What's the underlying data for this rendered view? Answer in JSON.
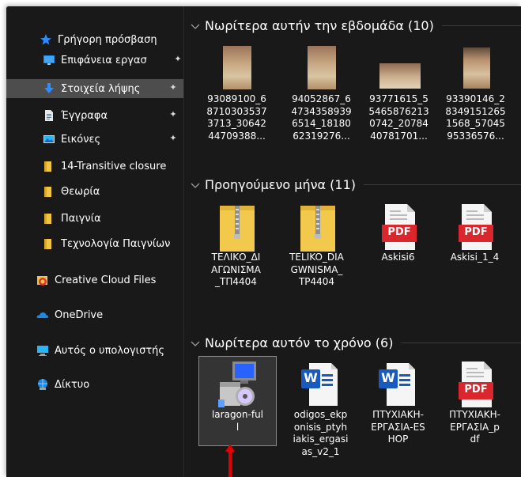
{
  "sidebar": {
    "items": [
      {
        "label": "Γρήγορη πρόσβαση",
        "icon": "star-icon",
        "pinned": false
      },
      {
        "label": "Επιφάνεια εργασ",
        "icon": "desktop-icon",
        "pinned": true
      },
      {
        "label": "Στοιχεία λήψης",
        "icon": "download-icon",
        "pinned": true,
        "selected": true
      },
      {
        "label": "Έγγραφα",
        "icon": "documents-icon",
        "pinned": true
      },
      {
        "label": "Εικόνες",
        "icon": "pictures-icon",
        "pinned": true
      },
      {
        "label": "14-Transitive closure",
        "icon": "folder-icon",
        "pinned": false
      },
      {
        "label": "Θεωρία",
        "icon": "folder-icon",
        "pinned": false
      },
      {
        "label": "Παιγνία",
        "icon": "folder-icon",
        "pinned": false
      },
      {
        "label": "Τεχνολογία Παιγνίων",
        "icon": "folder-icon",
        "pinned": false
      },
      {
        "label": "Creative Cloud Files",
        "icon": "creative-cloud-icon",
        "pinned": false
      },
      {
        "label": "OneDrive",
        "icon": "onedrive-icon",
        "pinned": false
      },
      {
        "label": "Αυτός ο υπολογιστής",
        "icon": "this-pc-icon",
        "pinned": false
      },
      {
        "label": "Δίκτυο",
        "icon": "network-icon",
        "pinned": false
      }
    ]
  },
  "groups": [
    {
      "title": "Νωρίτερα αυτήν την εβδομάδα (10)",
      "items": [
        {
          "name": "93089100_68710303537 3713_3064244709388...",
          "lines": [
            "93089100_6",
            "8710303537",
            "3713_30642",
            "44709388..."
          ],
          "type": "photo"
        },
        {
          "name": "94052867_64734358939 6514_1818062319276...",
          "lines": [
            "94052867_6",
            "4734358939",
            "6514_18180",
            "62319276..."
          ],
          "type": "photo"
        },
        {
          "name": "93771615_55465876213 0742_2078440781701...",
          "lines": [
            "93771615_5",
            "5465876213",
            "0742_20784",
            "40781701..."
          ],
          "type": "photo-wide"
        },
        {
          "name": "93390146_28349151265 1568_5704595336576...",
          "lines": [
            "93390146_2",
            "8349151265",
            "1568_57045",
            "95336576..."
          ],
          "type": "photo-dark"
        }
      ]
    },
    {
      "title": "Προηγούμενο μήνα (11)",
      "items": [
        {
          "lines": [
            "ΤΕΛΙΚΟ_ΔΙ",
            "ΑΓΩΝΙΣΜΑ",
            "_ΤΠ4404"
          ],
          "type": "zip"
        },
        {
          "lines": [
            "TELIKO_DIA",
            "GWNISMA_",
            "TP4404"
          ],
          "type": "zip"
        },
        {
          "lines": [
            "Askisi6"
          ],
          "type": "pdf"
        },
        {
          "lines": [
            "Askisi_1_4"
          ],
          "type": "pdf"
        }
      ]
    },
    {
      "title": "Νωρίτερα αυτόν το χρόνο (6)",
      "items": [
        {
          "lines": [
            "laragon-ful",
            "l"
          ],
          "type": "installer",
          "selected": true
        },
        {
          "lines": [
            "odigos_ekp",
            "onisis_ptyh",
            "iakis_ergasi",
            "as_v2_1"
          ],
          "type": "word"
        },
        {
          "lines": [
            "ΠΤΥΧΙΑΚΗ-",
            "ΕΡΓΑΣΙΑ-ΕS",
            "HOP"
          ],
          "type": "word"
        },
        {
          "lines": [
            "ΠΤΥΧΙΑΚΗ-",
            "ΕΡΓΑΣΙΑ_p",
            "df"
          ],
          "type": "pdf"
        }
      ]
    }
  ],
  "pdf_badge": "PDF",
  "word_badge": "W",
  "colors": {
    "window_bg": "#191919",
    "selected_nav": "#4d4d4d",
    "folder": "#f0c542",
    "pdf_red": "#d9272d",
    "word_blue": "#185abd",
    "annotation_arrow": "#e00000"
  }
}
